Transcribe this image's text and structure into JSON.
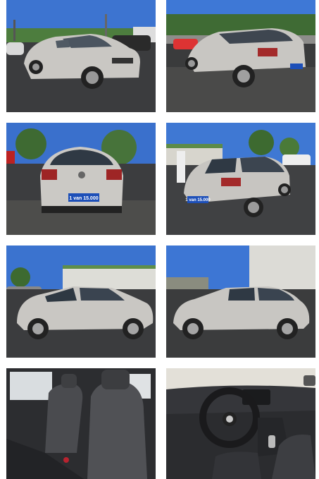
{
  "gallery": {
    "photos": [
      {
        "view": "front-three-quarter-right",
        "plate_text": ""
      },
      {
        "view": "rear-three-quarter-left",
        "plate_text": ""
      },
      {
        "view": "rear",
        "plate_text": "1 van 15.000"
      },
      {
        "view": "rear-three-quarter-left",
        "plate_text": "1 van 15.000"
      },
      {
        "view": "side-right",
        "plate_text": ""
      },
      {
        "view": "side-left",
        "plate_text": ""
      },
      {
        "view": "interior-front-seats",
        "plate_text": ""
      },
      {
        "view": "interior-dashboard",
        "plate_text": ""
      }
    ]
  },
  "colors": {
    "sky": "#3a6fc9",
    "car_silver": "#c8c6c2",
    "asphalt": "#3a3b3d",
    "interior": "#2f3033",
    "plate_blue": "#1d4fb8"
  }
}
